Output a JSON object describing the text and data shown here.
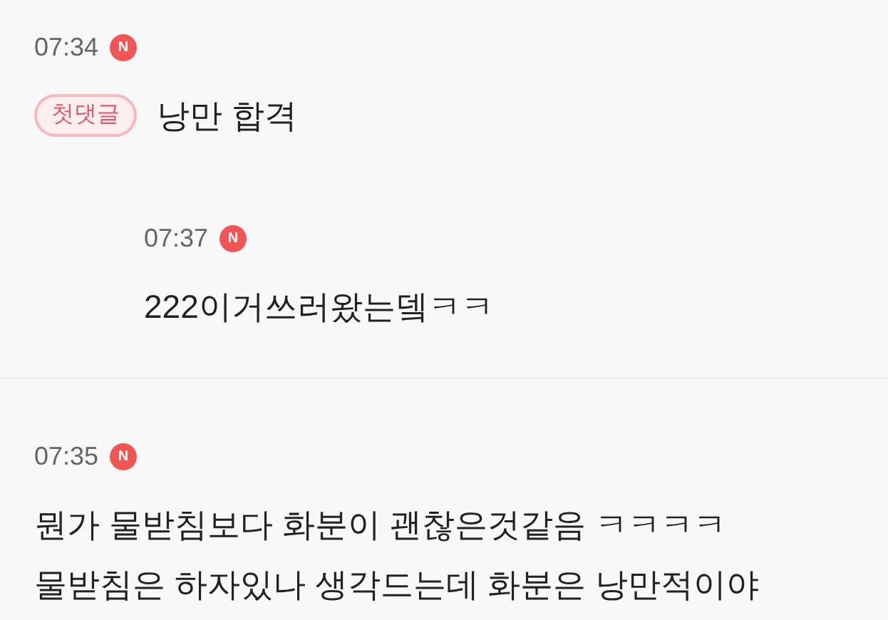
{
  "comments": [
    {
      "time": "07:34",
      "badge": "N",
      "tag": "첫댓글",
      "lines": [
        "낭만 합격"
      ],
      "children": [
        {
          "time": "07:37",
          "badge": "N",
          "lines": [
            "222이거쓰러왔는뎈ㅋㅋ"
          ]
        }
      ]
    },
    {
      "time": "07:35",
      "badge": "N",
      "lines": [
        "뭔가 물받침보다 화분이 괜찮은것같음 ㅋㅋㅋㅋ",
        "물받침은 하자있나 생각드는데 화분은 낭만적이야"
      ]
    }
  ]
}
